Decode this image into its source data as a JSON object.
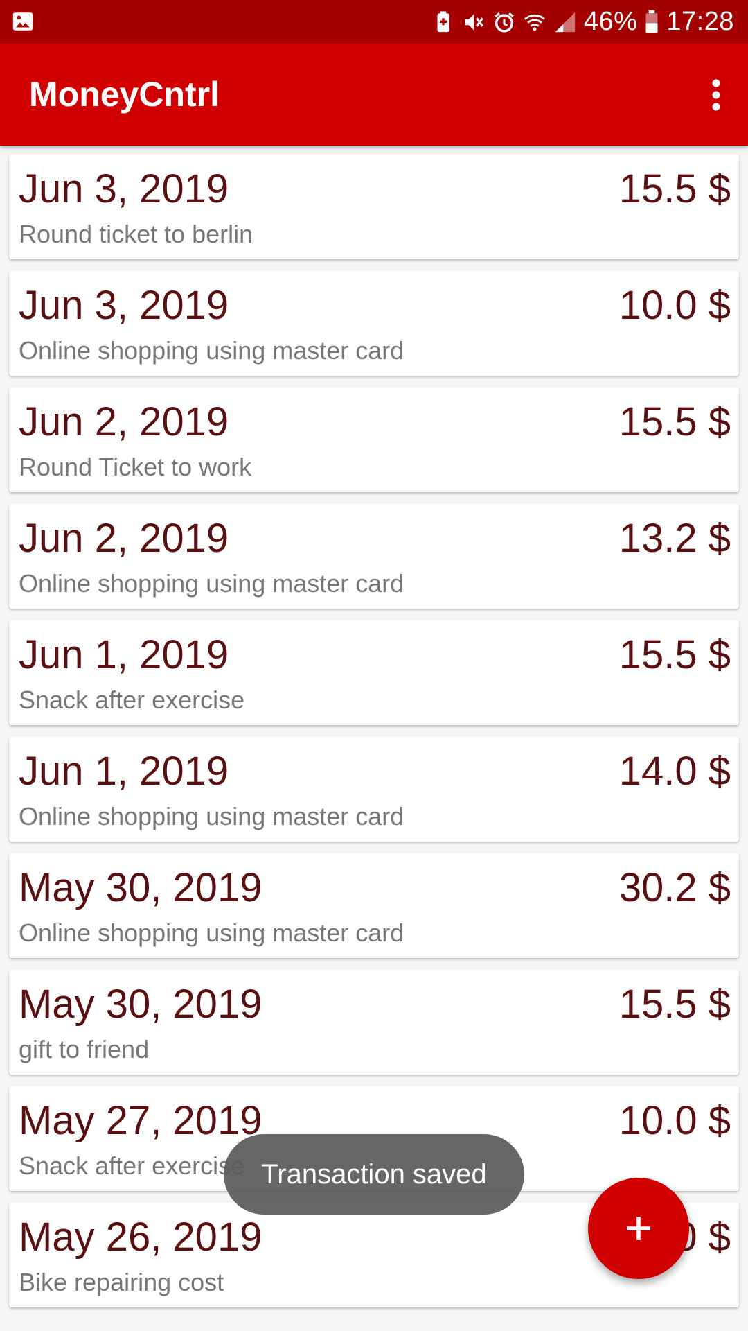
{
  "status_bar": {
    "icons": [
      "image-icon",
      "battery-saver-icon",
      "mute-icon",
      "alarm-icon",
      "wifi-icon",
      "signal-icon",
      "battery-icon"
    ],
    "battery": "46%",
    "time": "17:28"
  },
  "app_bar": {
    "title": "MoneyCntrl",
    "menu_icon": "more-vert-icon"
  },
  "colors": {
    "status_bar": "#a50000",
    "app_bar": "#d10000",
    "accent": "#d10000",
    "amount_text": "#5a1010",
    "secondary_text": "#777777"
  },
  "transactions": [
    {
      "date": "Jun 3, 2019",
      "amount": "15.5 $",
      "description": "Round ticket to berlin"
    },
    {
      "date": "Jun 3, 2019",
      "amount": "10.0 $",
      "description": "Online shopping using master card"
    },
    {
      "date": "Jun 2, 2019",
      "amount": "15.5 $",
      "description": "Round Ticket to work"
    },
    {
      "date": "Jun 2, 2019",
      "amount": "13.2 $",
      "description": "Online shopping using master card"
    },
    {
      "date": "Jun 1, 2019",
      "amount": "15.5 $",
      "description": "Snack after exercise"
    },
    {
      "date": "Jun 1, 2019",
      "amount": "14.0 $",
      "description": "Online shopping using master card"
    },
    {
      "date": "May 30, 2019",
      "amount": "30.2 $",
      "description": "Online shopping using master card"
    },
    {
      "date": "May 30, 2019",
      "amount": "15.5 $",
      "description": "gift to friend"
    },
    {
      "date": "May 27, 2019",
      "amount": "10.0 $",
      "description": "Snack after exercise"
    },
    {
      "date": "May 26, 2019",
      "amount": "0 $",
      "description": "Bike repairing cost"
    }
  ],
  "toast": {
    "message": "Transaction saved"
  },
  "fab": {
    "icon": "plus-icon"
  }
}
